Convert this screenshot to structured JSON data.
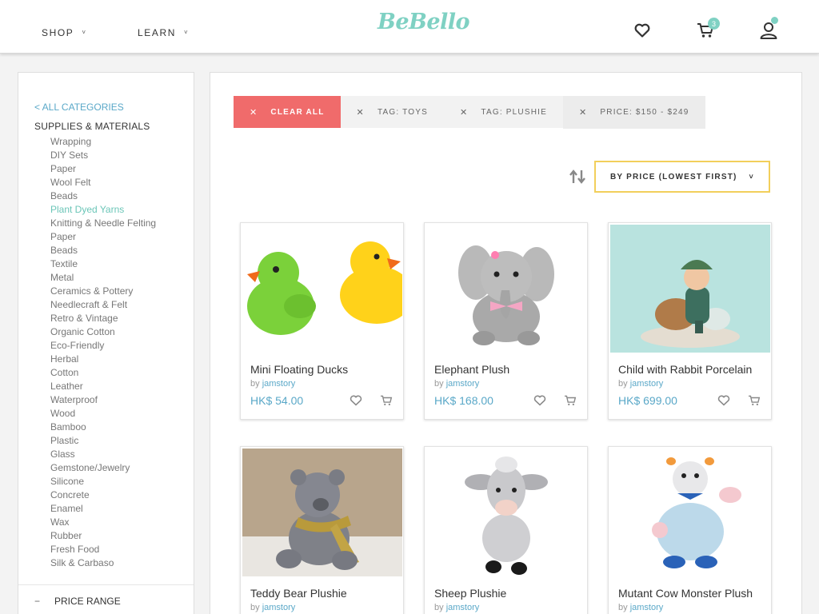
{
  "header": {
    "nav": [
      {
        "label": "SHOP"
      },
      {
        "label": "LEARN"
      }
    ],
    "logo": "BeBello",
    "cart_count": "3"
  },
  "sidebar": {
    "all_categories": "< ALL CATEGORIES",
    "heading": "SUPPLIES & MATERIALS",
    "items": [
      "Wrapping",
      "DIY Sets",
      "Paper",
      "Wool Felt",
      "Beads",
      "Plant Dyed Yarns",
      "Knitting & Needle Felting",
      "Paper",
      "Beads",
      "Textile",
      "Metal",
      "Ceramics & Pottery",
      "Needlecraft & Felt",
      "Retro & Vintage",
      "Organic Cotton",
      "Eco-Friendly",
      "Herbal",
      "Cotton",
      "Leather",
      "Waterproof",
      "Wood",
      "Bamboo",
      "Plastic",
      "Glass",
      "Gemstone/Jewelry",
      "Silicone",
      "Concrete",
      "Enamel",
      "Wax",
      "Rubber",
      "Fresh Food",
      "Silk & Carbaso"
    ],
    "active_item": "Plant Dyed Yarns",
    "price_toggle": "−",
    "price_range": "PRICE RANGE"
  },
  "filters": {
    "clear_all": "CLEAR ALL",
    "tags": [
      "TAG: TOYS",
      "TAG: PLUSHIE",
      "PRICE: $150 - $249"
    ]
  },
  "sort": {
    "label": "BY PRICE (LOWEST FIRST)"
  },
  "products": [
    {
      "title": "Mini Floating Ducks",
      "by": "by",
      "seller": "jamstory",
      "price": "HK$ 54.00"
    },
    {
      "title": "Elephant Plush",
      "by": "by",
      "seller": "jamstory",
      "price": "HK$ 168.00"
    },
    {
      "title": "Child with Rabbit Porcelain",
      "by": "by",
      "seller": "jamstory",
      "price": "HK$ 699.00"
    },
    {
      "title": "Teddy Bear Plushie",
      "by": "by",
      "seller": "jamstory",
      "price": ""
    },
    {
      "title": "Sheep Plushie",
      "by": "by",
      "seller": "jamstory",
      "price": ""
    },
    {
      "title": "Mutant Cow Monster Plush",
      "by": "by",
      "seller": "jamstory",
      "price": ""
    }
  ],
  "colors": {
    "accent": "#7fd1c3",
    "link": "#5aa8c8",
    "clear": "#f06b6b",
    "sort_border": "#f2cf5b"
  }
}
